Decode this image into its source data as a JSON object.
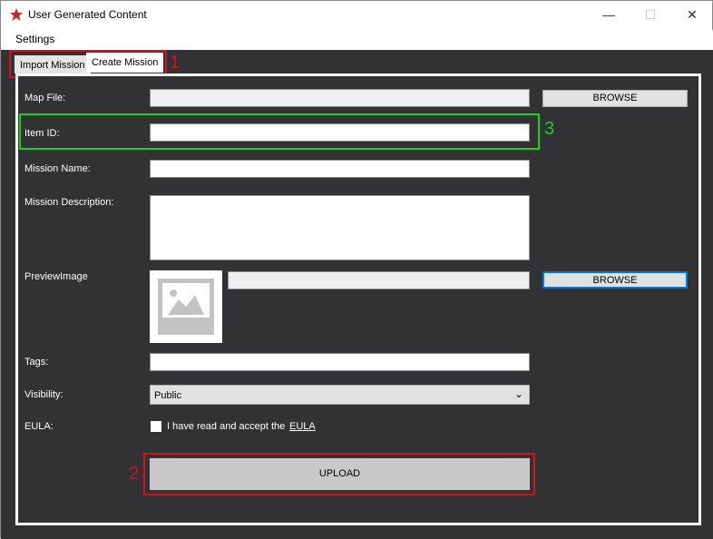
{
  "window": {
    "title": "User Generated Content",
    "minimize": "—",
    "maximize": "☐",
    "close": "✕"
  },
  "menu": {
    "settings": "Settings"
  },
  "tabs": [
    {
      "label": "Import Mission"
    },
    {
      "label": "Create Mission",
      "active": true
    }
  ],
  "form": {
    "map_file_label": "Map File:",
    "browse_label": "BROWSE",
    "item_id_label": "Item ID:",
    "mission_name_label": "Mission Name:",
    "mission_description_label": "Mission Description:",
    "preview_image_label": "PreviewImage",
    "preview_browse_label": "BROWSE",
    "tags_label": "Tags:",
    "visibility_label": "Visibility:",
    "visibility_value": "Public",
    "eula_label": "EULA:",
    "eula_text": "I have read and accept the",
    "eula_link": "EULA",
    "upload_label": "UPLOAD"
  },
  "annotations": {
    "a1": "1",
    "a2": "2",
    "a3": "3"
  },
  "colors": {
    "red": "#d0141a",
    "green": "#22cc22",
    "bg": "#323133"
  }
}
